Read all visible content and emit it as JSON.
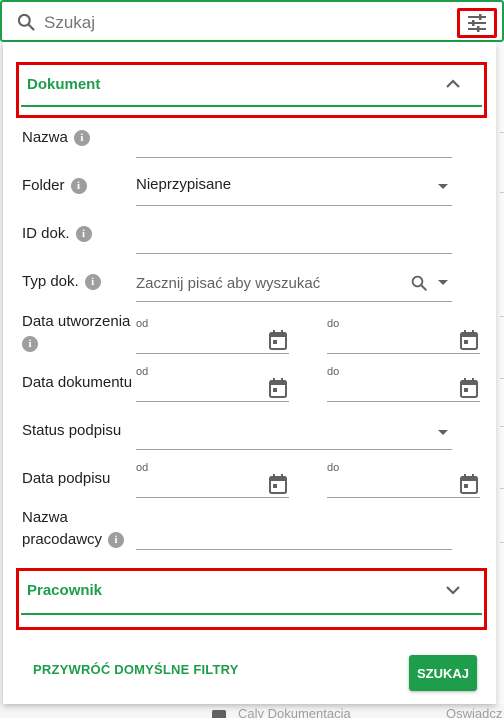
{
  "search": {
    "placeholder": "Szukaj"
  },
  "sections": {
    "dokument": "Dokument",
    "pracownik": "Pracownik"
  },
  "fields": {
    "nazwa": "Nazwa",
    "folder": "Folder",
    "folder_value": "Nieprzypisane",
    "id_dok": "ID dok.",
    "typ_dok": "Typ dok.",
    "typ_dok_placeholder": "Zacznij pisać aby wyszukać",
    "data_utworzenia": "Data utworzenia",
    "data_dokumentu": "Data dokumentu",
    "status_podpisu": "Status podpisu",
    "data_podpisu": "Data podpisu",
    "nazwa_pracodawcy_line1": "Nazwa",
    "nazwa_pracodawcy_line2": "pracodawcy",
    "od": "od",
    "do": "do",
    "info": "i"
  },
  "actions": {
    "reset": "PRZYWRÓĆ DOMYŚLNE FILTRY",
    "search": "SZUKAJ"
  },
  "background": {
    "row_text": "Caly Dokumentacja",
    "row_text2": "Oswiadcz"
  },
  "colors": {
    "accent": "#1e9e4a",
    "highlight": "#e00000"
  }
}
